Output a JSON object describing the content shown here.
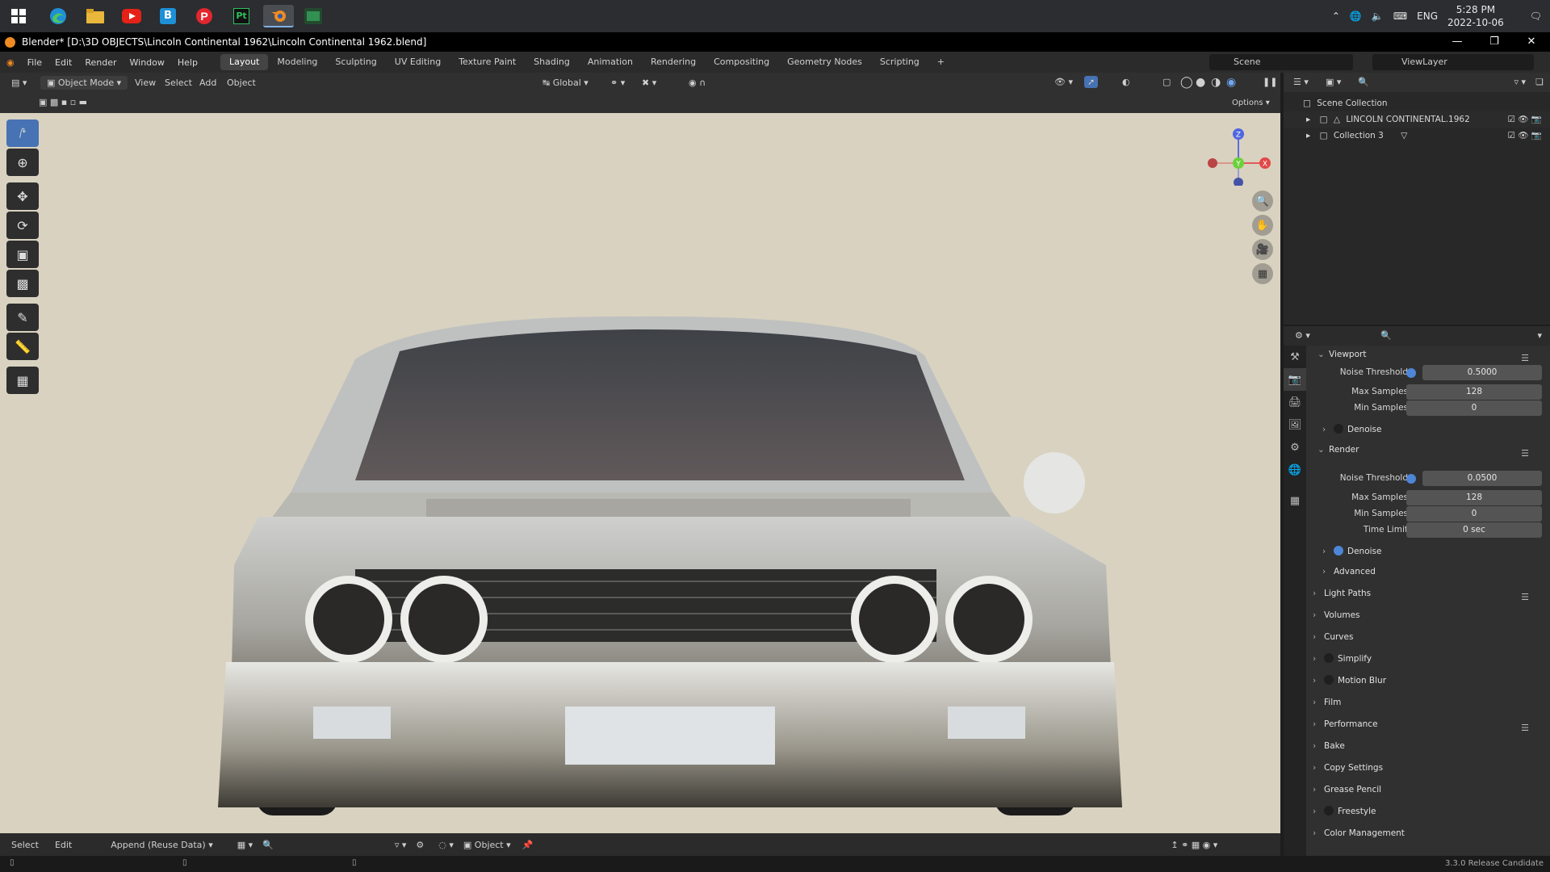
{
  "window": {
    "title": "Blender* [D:\\3D OBJECTS\\Lincoln Continental 1962\\Lincoln Continental 1962.blend]"
  },
  "taskbar": {
    "language": "ENG",
    "time": "5:28 PM",
    "date": "2022-10-06",
    "pt_label": "Pt"
  },
  "menu": {
    "items": [
      "File",
      "Edit",
      "Render",
      "Window",
      "Help"
    ],
    "workspaces": [
      "Layout",
      "Modeling",
      "Sculpting",
      "UV Editing",
      "Texture Paint",
      "Shading",
      "Animation",
      "Rendering",
      "Compositing",
      "Geometry Nodes",
      "Scripting"
    ],
    "active_workspace": "Layout",
    "scene": "Scene",
    "view_layer": "ViewLayer"
  },
  "viewport_header": {
    "mode": "Object Mode",
    "menus": [
      "View",
      "Select",
      "Add",
      "Object"
    ],
    "transform": "Global",
    "options": "Options"
  },
  "gizmo": {
    "z": "Z",
    "y": "Y",
    "x": "X"
  },
  "outliner": {
    "root": "Scene Collection",
    "items": [
      "LINCOLN CONTINENTAL.1962",
      "Collection 3"
    ]
  },
  "properties": {
    "viewport_section": "Viewport",
    "viewport": {
      "noise_threshold_label": "Noise Threshold",
      "noise_threshold": "0.5000",
      "max_samples_label": "Max Samples",
      "max_samples": "128",
      "min_samples_label": "Min Samples",
      "min_samples": "0",
      "denoise": "Denoise"
    },
    "render_section": "Render",
    "render": {
      "noise_threshold_label": "Noise Threshold",
      "noise_threshold": "0.0500",
      "max_samples_label": "Max Samples",
      "max_samples": "128",
      "min_samples_label": "Min Samples",
      "min_samples": "0",
      "time_limit_label": "Time Limit",
      "time_limit": "0 sec",
      "denoise": "Denoise",
      "advanced": "Advanced"
    },
    "panels": [
      "Light Paths",
      "Volumes",
      "Curves",
      "Simplify",
      "Motion Blur",
      "Film",
      "Performance",
      "Bake",
      "Copy Settings",
      "Grease Pencil",
      "Freestyle",
      "Color Management"
    ]
  },
  "bottombar": {
    "select": "Select",
    "edit": "Edit",
    "append": "Append (Reuse Data)",
    "object": "Object"
  },
  "status": {
    "version": "3.3.0 Release Candidate"
  }
}
